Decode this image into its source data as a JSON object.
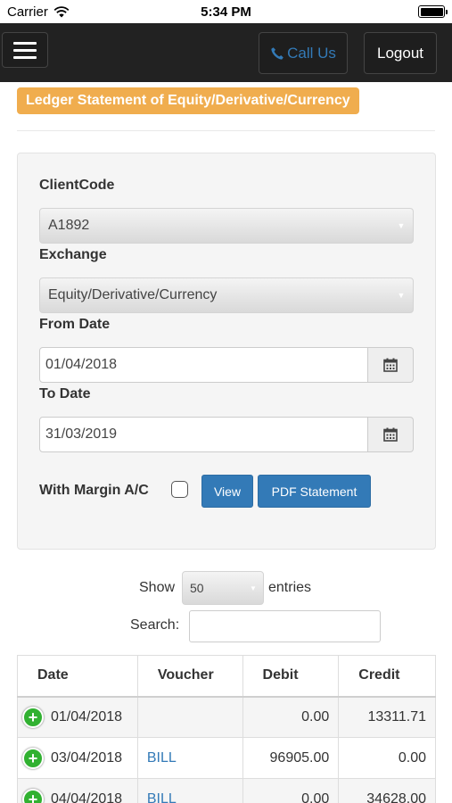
{
  "status_bar": {
    "carrier": "Carrier",
    "time": "5:34 PM"
  },
  "navbar": {
    "call_label": "Call Us",
    "logout_label": "Logout"
  },
  "page_title": "Ledger Statement of Equity/Derivative/Currency",
  "form": {
    "client_code_label": "ClientCode",
    "client_code_value": "A1892",
    "exchange_label": "Exchange",
    "exchange_value": "Equity/Derivative/Currency",
    "from_date_label": "From Date",
    "from_date_value": "01/04/2018",
    "to_date_label": "To Date",
    "to_date_value": "31/03/2019",
    "margin_label": "With Margin A/C",
    "view_label": "View",
    "pdf_label": "PDF Statement"
  },
  "table_controls": {
    "show_label": "Show",
    "entries_value": "50",
    "entries_label": "entries",
    "search_label": "Search:"
  },
  "table": {
    "headers": [
      "Date",
      "Voucher",
      "Debit",
      "Credit"
    ],
    "rows": [
      {
        "date": "01/04/2018",
        "voucher": "",
        "debit": "0.00",
        "credit": "13311.71"
      },
      {
        "date": "03/04/2018",
        "voucher": "BILL",
        "debit": "96905.00",
        "credit": "0.00"
      },
      {
        "date": "04/04/2018",
        "voucher": "BILL",
        "debit": "0.00",
        "credit": "34628.00"
      }
    ]
  },
  "colors": {
    "navbar": "#222222",
    "title_badge": "#f0ad4e",
    "primary": "#337ab7",
    "expand_icon": "#31b131"
  }
}
